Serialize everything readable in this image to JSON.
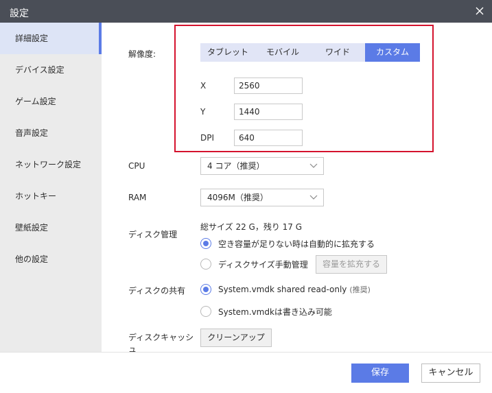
{
  "window": {
    "title": "設定",
    "close_icon": "close-icon"
  },
  "sidebar": {
    "items": [
      {
        "label": "詳細設定",
        "active": true
      },
      {
        "label": "デバイス設定",
        "active": false
      },
      {
        "label": "ゲーム設定",
        "active": false
      },
      {
        "label": "音声設定",
        "active": false
      },
      {
        "label": "ネットワーク設定",
        "active": false
      },
      {
        "label": "ホットキー",
        "active": false
      },
      {
        "label": "壁紙設定",
        "active": false
      },
      {
        "label": "他の設定",
        "active": false
      }
    ]
  },
  "resolution": {
    "label": "解像度:",
    "tabs": [
      {
        "label": "タブレット",
        "active": false
      },
      {
        "label": "モバイル",
        "active": false
      },
      {
        "label": "ワイド",
        "active": false
      },
      {
        "label": "カスタム",
        "active": true
      }
    ],
    "x_label": "X",
    "x_value": "2560",
    "y_label": "Y",
    "y_value": "1440",
    "dpi_label": "DPI",
    "dpi_value": "640"
  },
  "cpu": {
    "label": "CPU",
    "selected": "4 コア（推奨）"
  },
  "ram": {
    "label": "RAM",
    "selected": "4096M（推奨）"
  },
  "disk": {
    "label": "ディスク管理",
    "summary": "総サイズ 22 G，残り 17 G",
    "option_auto": "空き容量が足りない時は自動的に拡充する",
    "option_manual": "ディスクサイズ手動管理",
    "expand_button": "容量を拡充する",
    "selected": "auto"
  },
  "share": {
    "label": "ディスクの共有",
    "option_readonly": "System.vmdk shared read-only",
    "option_readonly_note": "(推奨)",
    "option_writable": "System.vmdkは書き込み可能",
    "selected": "readonly"
  },
  "cache": {
    "label_line1": "ディスクキャッシ",
    "label_line2": "ュ",
    "cleanup_button": "クリーンアップ"
  },
  "footer": {
    "save_label": "保存",
    "cancel_label": "キャンセル"
  },
  "colors": {
    "accent": "#5b7be6",
    "highlight_box": "#d4122d",
    "titlebar": "#4a4e57"
  }
}
